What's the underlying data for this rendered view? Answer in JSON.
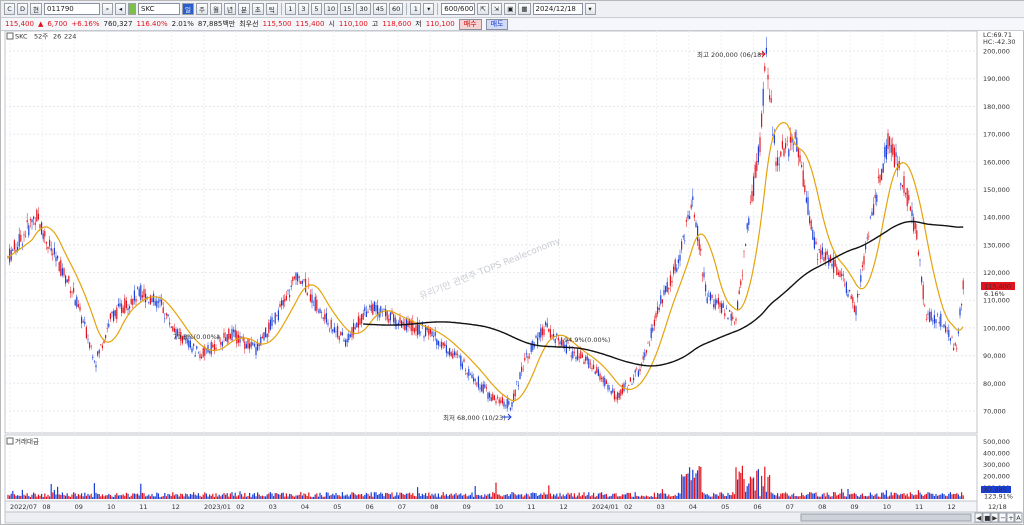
{
  "toolbar": {
    "code": "011790",
    "stock_name": "SKC",
    "period_buttons": [
      "주",
      "월",
      "년",
      "분",
      "초",
      "틱"
    ],
    "minute_buttons": [
      "1",
      "3",
      "5",
      "10",
      "15",
      "30",
      "45",
      "60"
    ],
    "count": "600/600",
    "date": "2024/12/18",
    "misc_labels": [
      "C",
      "D",
      "현",
      "1"
    ]
  },
  "quote": {
    "price": "115,400",
    "change_arrow": "▲",
    "change": "6,700",
    "change_pct": "+6.16%",
    "volume": "760,327",
    "vol_ratio": "116.40%",
    "turnover_pct": "2.01%",
    "amount": "87,885백만",
    "best_label": "최우선",
    "best_sell": "115,500",
    "best_buy": "115,400",
    "open_label": "시",
    "open": "110,100",
    "high_label": "고",
    "high": "118,600",
    "low_label": "저",
    "low": "110,100",
    "buy_btn": "매수",
    "sell_btn": "매도"
  },
  "chart": {
    "legend": {
      "name": "SKC",
      "ma1": "52주",
      "ma2": "26",
      "ma3": "224"
    },
    "lc": "LC:69.71",
    "hc": "HC:-42.30",
    "max_label": "최고 200,000 (06/18)",
    "min_label": "최저 68,000 (10/23)",
    "watermark": "유리기만 관련주 TOPS Realeconomy",
    "ma_labels": [
      "79.8%(0.00%)",
      "94.9%(0.00%)"
    ],
    "current_tag": "115,400",
    "current_pct": "6.16%",
    "y_ticks": [
      "200,000",
      "190,000",
      "180,000",
      "170,000",
      "160,000",
      "150,000",
      "140,000",
      "130,000",
      "120,000",
      "110,000",
      "100,000",
      "90,000",
      "80,000",
      "70,000"
    ],
    "x_ticks": [
      "2022/07",
      "08",
      "09",
      "10",
      "11",
      "12",
      "2023/01",
      "02",
      "03",
      "04",
      "05",
      "06",
      "07",
      "08",
      "09",
      "10",
      "11",
      "12",
      "2024/01",
      "02",
      "03",
      "04",
      "05",
      "06",
      "07",
      "08",
      "09",
      "10",
      "11",
      "12"
    ],
    "volume_label": "거래대금",
    "vol_ticks": [
      "500,000",
      "400,000",
      "300,000",
      "200,000",
      "100,000"
    ],
    "vol_current": "87,885",
    "vol_pct": "123.91%",
    "last_date": "12/18",
    "colors": {
      "up": "#e0141e",
      "down": "#1a3fd6",
      "ma26": "#e5a30c",
      "ma224": "#111111"
    }
  }
}
